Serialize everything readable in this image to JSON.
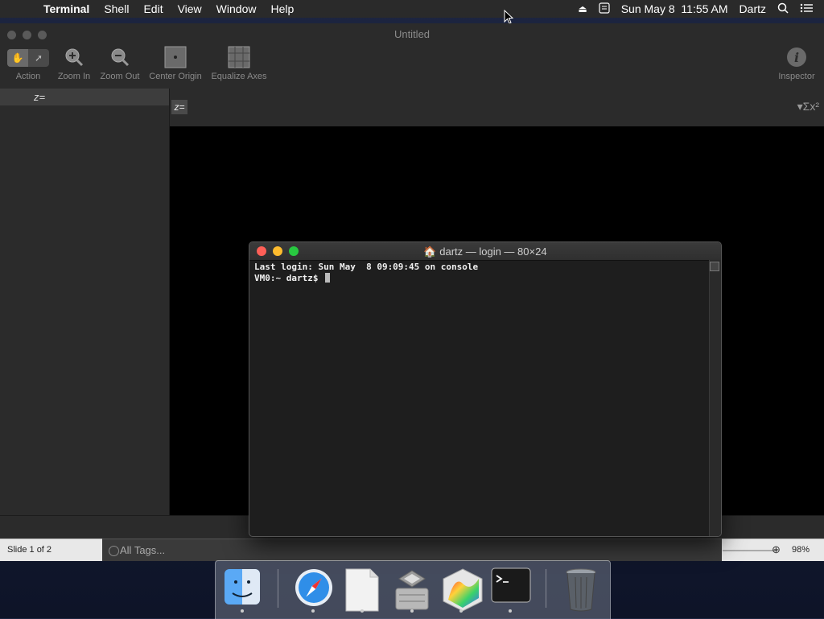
{
  "menubar": {
    "app_name": "Terminal",
    "items": [
      "Shell",
      "Edit",
      "View",
      "Window",
      "Help"
    ],
    "clock": "Sun May 8  11:55 AM",
    "user": "Dartz"
  },
  "grapher": {
    "title": "Untitled",
    "toolbar": {
      "action": "Action",
      "zoom_in": "Zoom In",
      "zoom_out": "Zoom Out",
      "center_origin": "Center Origin",
      "equalize_axes": "Equalize Axes",
      "inspector": "Inspector"
    },
    "sidebar_row": "z=",
    "equation_prefix": "z=",
    "add_symbol": "+"
  },
  "terminal": {
    "title": "dartz — login — 80×24",
    "lines": [
      "Last login: Sun May  8 09:09:45 on console",
      "VM0:~ dartz$ "
    ]
  },
  "bottom": {
    "slide_indicator": "Slide 1 of 2",
    "tags_label": "All Tags...",
    "zoom_level": "98%"
  },
  "dock": {
    "apps": [
      "finder-icon",
      "safari-icon",
      "textedit-icon",
      "bootcamp-icon",
      "grapher-icon",
      "terminal-icon",
      "trash-icon"
    ]
  }
}
